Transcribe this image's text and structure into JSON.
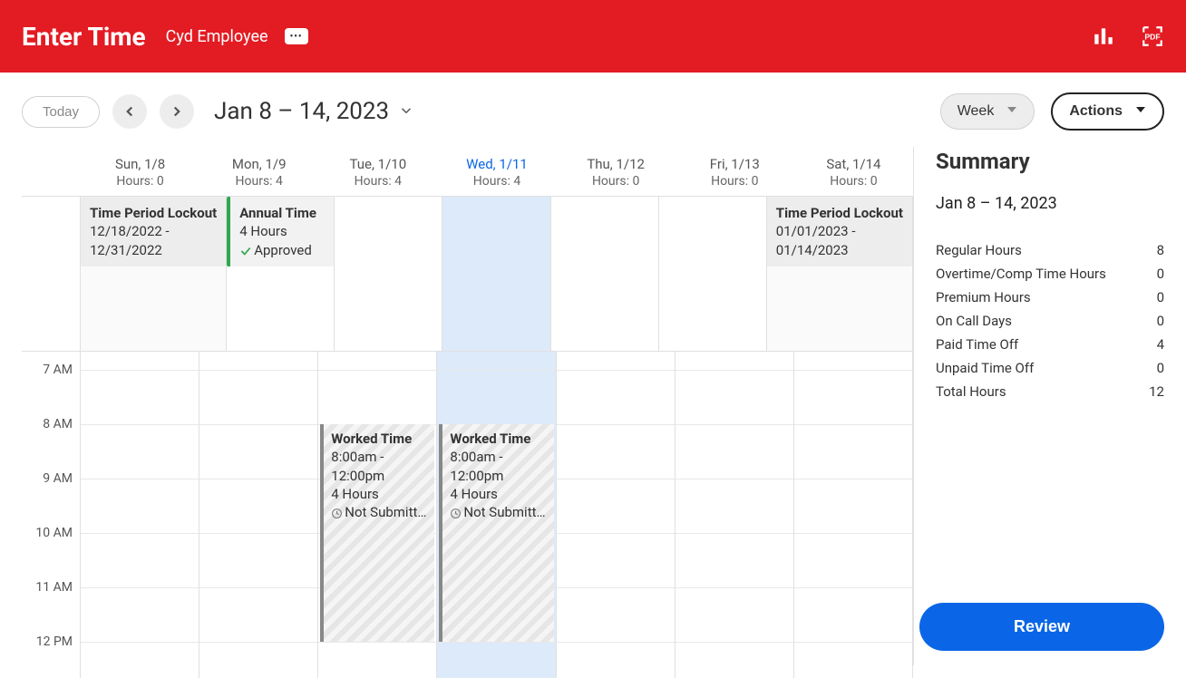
{
  "header": {
    "title": "Enter Time",
    "employee": "Cyd Employee",
    "ellipsis": "•••"
  },
  "toolbar": {
    "today_label": "Today",
    "date_range": "Jan 8 – 14, 2023",
    "view_label": "Week",
    "actions_label": "Actions"
  },
  "days": [
    {
      "label": "Sun, 1/8",
      "hours": "Hours: 0",
      "selected": false,
      "weekend": true
    },
    {
      "label": "Mon, 1/9",
      "hours": "Hours: 4",
      "selected": false,
      "weekend": false
    },
    {
      "label": "Tue, 1/10",
      "hours": "Hours: 4",
      "selected": false,
      "weekend": false
    },
    {
      "label": "Wed, 1/11",
      "hours": "Hours: 4",
      "selected": true,
      "weekend": false
    },
    {
      "label": "Thu, 1/12",
      "hours": "Hours: 0",
      "selected": false,
      "weekend": false
    },
    {
      "label": "Fri, 1/13",
      "hours": "Hours: 0",
      "selected": false,
      "weekend": false
    },
    {
      "label": "Sat, 1/14",
      "hours": "Hours: 0",
      "selected": false,
      "weekend": true
    }
  ],
  "allday": {
    "sun": {
      "title": "Time Period Lockout",
      "line1": "12/18/2022 -",
      "line2": "12/31/2022"
    },
    "mon": {
      "title": "Annual Time",
      "line1": "4 Hours",
      "status": "Approved"
    },
    "sat": {
      "title": "Time Period Lockout",
      "line1": "01/01/2023 -",
      "line2": "01/14/2023"
    }
  },
  "hours": [
    "7 AM",
    "8 AM",
    "9 AM",
    "10 AM",
    "11 AM",
    "12 PM"
  ],
  "time_blocks": {
    "tue": {
      "title": "Worked Time",
      "line1": "8:00am -",
      "line2": "12:00pm",
      "line3": "4 Hours",
      "status": "Not Submitted"
    },
    "wed": {
      "title": "Worked Time",
      "line1": "8:00am -",
      "line2": "12:00pm",
      "line3": "4 Hours",
      "status": "Not Submitted"
    }
  },
  "summary": {
    "title": "Summary",
    "date_range": "Jan 8 – 14, 2023",
    "rows": [
      {
        "label": "Regular Hours",
        "value": "8"
      },
      {
        "label": "Overtime/Comp Time Hours",
        "value": "0"
      },
      {
        "label": "Premium Hours",
        "value": "0"
      },
      {
        "label": "On Call Days",
        "value": "0"
      },
      {
        "label": "Paid Time Off",
        "value": "4"
      },
      {
        "label": "Unpaid Time Off",
        "value": "0"
      },
      {
        "label": "Total Hours",
        "value": "12"
      }
    ],
    "review_label": "Review"
  }
}
